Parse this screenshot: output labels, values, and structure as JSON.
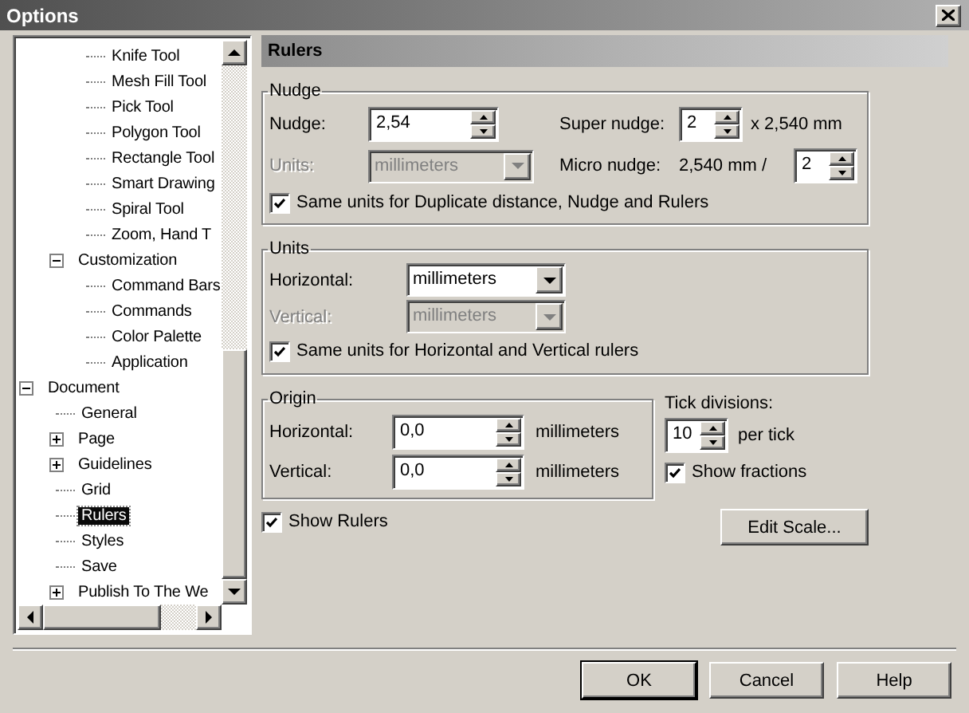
{
  "window": {
    "title": "Options"
  },
  "tree": {
    "items": [
      {
        "children": [
          {
            "children": [
              {
                "label": "Knife Tool",
                "selected": false
              },
              {
                "label": "Mesh Fill Tool",
                "selected": false
              },
              {
                "label": "Pick Tool",
                "selected": false
              },
              {
                "label": "Polygon Tool",
                "selected": false
              },
              {
                "label": "Rectangle Tool",
                "selected": false
              },
              {
                "label": "Smart Drawing",
                "selected": false
              },
              {
                "label": "Spiral Tool",
                "selected": false
              },
              {
                "label": "Zoom, Hand T",
                "selected": false
              }
            ]
          },
          {
            "label": "Customization",
            "selected": false,
            "expanded": true,
            "children": [
              {
                "label": "Command Bars",
                "selected": false
              },
              {
                "label": "Commands",
                "selected": false
              },
              {
                "label": "Color Palette",
                "selected": false
              },
              {
                "label": "Application",
                "selected": false
              }
            ]
          }
        ]
      },
      {
        "label": "Document",
        "selected": false,
        "expanded": true,
        "children": [
          {
            "label": "General",
            "selected": false
          },
          {
            "label": "Page",
            "selected": false,
            "expanded": false
          },
          {
            "label": "Guidelines",
            "selected": false,
            "expanded": false
          },
          {
            "label": "Grid",
            "selected": false
          },
          {
            "label": "Rulers",
            "selected": true
          },
          {
            "label": "Styles",
            "selected": false
          },
          {
            "label": "Save",
            "selected": false
          },
          {
            "label": "Publish To The We",
            "selected": false,
            "expanded": false
          }
        ]
      }
    ]
  },
  "panel": {
    "title": "Rulers"
  },
  "nudge_group": {
    "title": "Nudge",
    "nudge": {
      "label": "Nudge:",
      "value": "2,54"
    },
    "units": {
      "label": "Units:",
      "value": "millimeters",
      "disabled": true
    },
    "super_nudge": {
      "label": "Super nudge:",
      "value": "2",
      "suffix": "x 2,540 mm"
    },
    "micro_nudge": {
      "label": "Micro nudge:",
      "prefix": "2,540 mm /",
      "value": "2"
    },
    "same_units": {
      "label": "Same units for Duplicate distance, Nudge and Rulers",
      "checked": true
    }
  },
  "units_group": {
    "title": "Units",
    "rows": [
      {
        "label": "Horizontal:",
        "value": "millimeters",
        "disabled": false
      },
      {
        "label": "Vertical:",
        "value": "millimeters",
        "disabled": true
      }
    ],
    "same_units": {
      "label": "Same units for Horizontal and Vertical rulers",
      "checked": true
    }
  },
  "origin_group": {
    "title": "Origin",
    "rows": [
      {
        "label": "Horizontal:",
        "value": "0,0",
        "unit": "millimeters"
      },
      {
        "label": "Vertical:",
        "value": "0,0",
        "unit": "millimeters"
      }
    ]
  },
  "tick_divisions": {
    "label": "Tick divisions:",
    "value": "10",
    "suffix": "per tick"
  },
  "show_fractions": {
    "label": "Show fractions",
    "checked": true
  },
  "show_rulers": {
    "label": "Show Rulers",
    "checked": true
  },
  "edit_scale_button": "Edit Scale...",
  "buttons": [
    {
      "label": "OK",
      "default": true
    },
    {
      "label": "Cancel",
      "default": false
    },
    {
      "label": "Help",
      "default": false
    }
  ]
}
